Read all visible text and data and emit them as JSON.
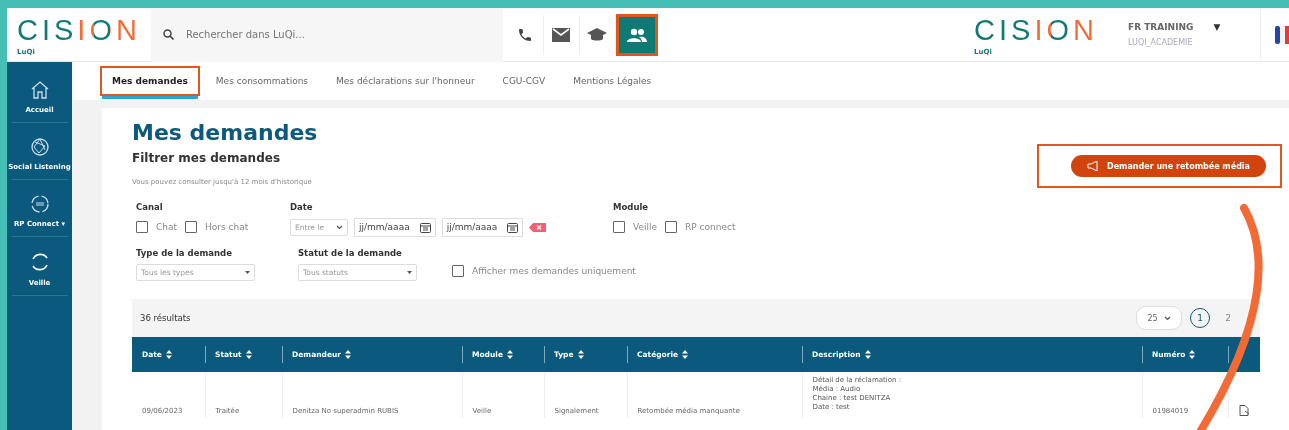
{
  "header": {
    "logo": {
      "brand": "CISION",
      "sub": "LuQi"
    },
    "search": {
      "placeholder": "Rechercher dans LuQi..."
    },
    "tools": [
      {
        "kind": "phone",
        "selected": false,
        "highlighted": false
      },
      {
        "kind": "mail",
        "selected": false,
        "highlighted": false
      },
      {
        "kind": "graduation",
        "selected": false,
        "highlighted": false
      },
      {
        "kind": "people",
        "selected": true,
        "highlighted": true
      }
    ],
    "right_logo": {
      "brand": "CISION",
      "sub": "LuQi"
    },
    "user": {
      "name": "FR TRAINING",
      "caret": "▼",
      "account": "LUQI_ACADEMIE"
    }
  },
  "sidebar": {
    "items": [
      {
        "kind": "home",
        "label": "Accueil"
      },
      {
        "kind": "globe",
        "label": "Social Listening"
      },
      {
        "kind": "connect",
        "label": "RP Connect ▾"
      },
      {
        "kind": "cycle",
        "label": "Veille"
      }
    ]
  },
  "tabs": [
    {
      "label": "Mes demandes",
      "selected": true,
      "highlighted": true
    },
    {
      "label": "Mes consommations",
      "selected": false,
      "highlighted": false
    },
    {
      "label": "Mes déclarations sur l'honneur",
      "selected": false,
      "highlighted": false
    },
    {
      "label": "CGU-CGV",
      "selected": false,
      "highlighted": false
    },
    {
      "label": "Mentions Légales",
      "selected": false,
      "highlighted": false
    }
  ],
  "page": {
    "title": "Mes demandes",
    "filter_title": "Filtrer mes demandes",
    "hint": "Vous pouvez consulter jusqu'à 12 mois d'historique",
    "action_button": {
      "label": "Demander une retombée média",
      "highlighted": true
    }
  },
  "filters": {
    "canal": {
      "label": "Canal",
      "options": [
        {
          "label": "Chat",
          "checked": false
        },
        {
          "label": "Hors chat",
          "checked": false
        }
      ]
    },
    "date": {
      "label": "Date",
      "range": "Entre le",
      "from_placeholder": "jj/mm/aaaa",
      "to_placeholder": "jj/mm/aaaa"
    },
    "module": {
      "label": "Module",
      "options": [
        {
          "label": "Veille",
          "checked": false
        },
        {
          "label": "RP connect",
          "checked": false
        }
      ]
    },
    "type": {
      "label": "Type de la demande",
      "value": "Tous les types"
    },
    "statut": {
      "label": "Statut de la demande",
      "value": "Tous statuts"
    },
    "only_mine": {
      "label": "Afficher mes demandes uniquement",
      "checked": false
    }
  },
  "results": {
    "count": "36 résultats",
    "page_size": "25",
    "pages": [
      {
        "label": "1",
        "selected": true
      },
      {
        "label": "2",
        "selected": false
      }
    ]
  },
  "table": {
    "columns": [
      "Date",
      "Statut",
      "Demandeur",
      "Module",
      "Type",
      "Catégorie",
      "Description",
      "Numéro"
    ],
    "rows": [
      {
        "cells": [
          "09/06/2023",
          "Traitée",
          "Denitza No superadmin RUBIS",
          "Veille",
          "Signalement",
          "Retombée média manquante",
          [
            "Détail de la réclamation :",
            "Média : Audio",
            "Chaine : test DENITZA",
            "Date : test"
          ],
          "01984019"
        ]
      }
    ]
  }
}
